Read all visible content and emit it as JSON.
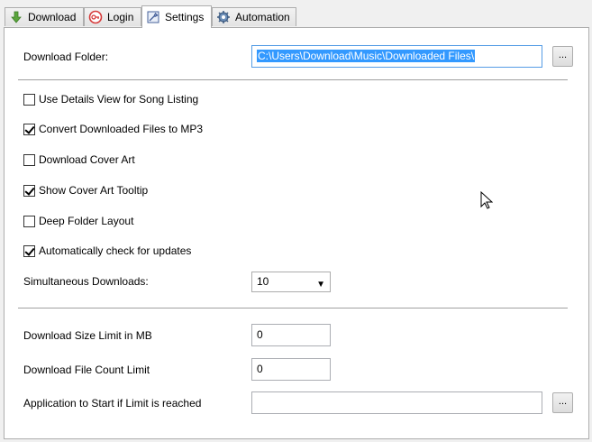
{
  "tabs": [
    {
      "label": "Download",
      "icon": "download-arrow-icon"
    },
    {
      "label": "Login",
      "icon": "login-icon"
    },
    {
      "label": "Settings",
      "icon": "settings-icon",
      "active": true
    },
    {
      "label": "Automation",
      "icon": "gear-icon"
    }
  ],
  "settings": {
    "download_folder_label": "Download Folder:",
    "download_folder_value": "C:\\Users\\Download\\Music\\Downloaded Files\\",
    "browse_label": "...",
    "options": [
      {
        "label": "Use Details View for Song Listing",
        "checked": false
      },
      {
        "label": "Convert Downloaded Files to MP3",
        "checked": true
      },
      {
        "label": "Download Cover Art",
        "checked": false
      },
      {
        "label": "Show Cover Art Tooltip",
        "checked": true
      },
      {
        "label": "Deep Folder Layout",
        "checked": false
      },
      {
        "label": "Automatically check for updates",
        "checked": true
      }
    ],
    "simultaneous_label": "Simultaneous Downloads:",
    "simultaneous_value": "10",
    "size_limit_label": "Download Size Limit in MB",
    "size_limit_value": "0",
    "count_limit_label": "Download File Count Limit",
    "count_limit_value": "0",
    "app_start_label": "Application to Start if Limit is reached",
    "app_start_value": "",
    "app_browse_label": "..."
  },
  "colors": {
    "selection": "#3399ff",
    "focus_border": "#569de5"
  }
}
